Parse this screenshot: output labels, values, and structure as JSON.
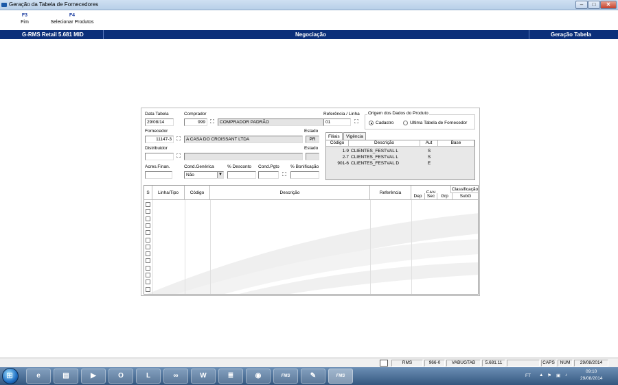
{
  "window": {
    "title": "Geração da Tabela de Fornecedores",
    "min_label": "–",
    "max_label": "□",
    "close_label": "✕"
  },
  "fkeys": [
    {
      "key": "F3",
      "label": "Fim"
    },
    {
      "key": "F4",
      "label": "Selecionar Produtos"
    }
  ],
  "header": {
    "left": "G-RMS Retail 5.681 MID",
    "center": "Negociação",
    "right": "Geração Tabela"
  },
  "form": {
    "data_tabela_label": "Data Tabela",
    "data_tabela": "29/08/14",
    "comprador_label": "Comprador",
    "comprador_codigo": "999",
    "comprador_nome": "COMPRADOR PADRÃO",
    "referencia_label": "Referência / Linha",
    "referencia": "01",
    "origem_label": "Origem dos Dados do Produto",
    "origem_opt1": "Cadastro",
    "origem_opt2": "Ultima Tabela de Fornecedor",
    "fornecedor_label": "Fornecedor",
    "fornecedor_codigo": "11147-3",
    "fornecedor_nome": "A CASA DO CROISSANT LTDA",
    "estado_label": "Estado",
    "fornecedor_estado": "PR",
    "distribuidor_label": "Distribuidor",
    "distribuidor_codigo": "",
    "distribuidor_nome": "",
    "distribuidor_estado_label": "Estado",
    "distribuidor_estado": "",
    "acres_label": "Acres.Finan.",
    "acres": "",
    "cond_generica_label": "Cond.Genérica",
    "cond_generica": "Não",
    "desconto_label": "% Desconto",
    "desconto": "",
    "cond_pgto_label": "Cond.Pgto",
    "cond_pgto": "",
    "bonificacao_label": "% Bonificação",
    "bonificacao": ""
  },
  "tabs": [
    "Filiais",
    "Vigência"
  ],
  "filiais": {
    "columns": [
      "Código",
      "Descrição",
      "Aut",
      "Base"
    ],
    "rows": [
      {
        "codigo": "1-9",
        "descricao": "CLIENTES_FESTVAL L",
        "aut": "S",
        "base": ""
      },
      {
        "codigo": "2-7",
        "descricao": "CLIENTES_FESTVAL L",
        "aut": "S",
        "base": ""
      },
      {
        "codigo": "901-6",
        "descricao": "CLIENTES_FESTVAL D",
        "aut": "E",
        "base": ""
      }
    ]
  },
  "produtos": {
    "columns": [
      "S",
      "Linha/Tipo",
      "Código",
      "Descrição",
      "Referência",
      "EAN"
    ],
    "classificacao_label": "Classificação",
    "classificacao_sub": [
      "Dep",
      "Sec",
      "Grp",
      "SubG"
    ],
    "row_count": 13
  },
  "statusbar": {
    "system": "RMS",
    "code": "966-0",
    "program": "VABUGTAB",
    "version": "5.681.11",
    "caps": "CAPS",
    "num": "NUM",
    "date": "29/08/2014"
  },
  "taskbar": {
    "lang": "FT",
    "time": "09:10",
    "date": "29/08/2014",
    "fms1": "FMS",
    "fms2": "FMS"
  }
}
